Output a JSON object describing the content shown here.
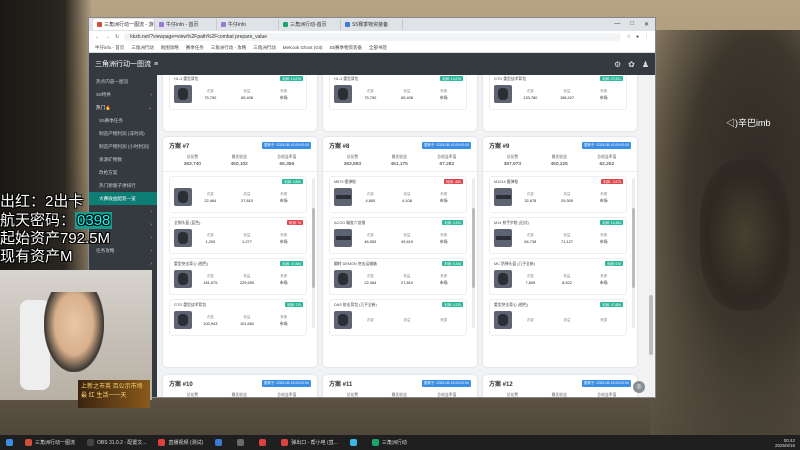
{
  "browser": {
    "tabs": [
      {
        "label": "三角洲行动一图流 - 游戏",
        "color": "#d24f3a",
        "active": true
      },
      {
        "label": "牛仔info - 首页",
        "color": "#9a7ad8",
        "active": false
      },
      {
        "label": "牛仔info",
        "color": "#9a7ad8",
        "active": false
      },
      {
        "label": "三角洲行动-首页",
        "color": "#1aa66b",
        "active": false
      },
      {
        "label": "S5赛季物资装备",
        "color": "#3a7ad8",
        "active": false
      }
    ],
    "url": "kkzb.net/?viewpage=view%2Fpath%2Fcombat prepare_value",
    "bookmarks": [
      "牛仔info - 首页",
      "三角洲行动",
      "地图攻略",
      "赛季任务",
      "三角洲行动 - 攻略",
      "三角洲行动",
      "MeKook Ghost (Git)",
      "S5赛季物资装备",
      "全部书签"
    ],
    "window_controls": [
      "—",
      "□",
      "✕"
    ]
  },
  "app": {
    "title": "三角洲行动一图流",
    "menu_icon": "≡",
    "header_icons": [
      "gear-icon",
      "settings-icon",
      "user-icon"
    ]
  },
  "sidebar": {
    "items": [
      {
        "label": "热点内容一图流",
        "arrow": "",
        "type": "top"
      },
      {
        "label": "S5特供",
        "arrow": "›",
        "type": "top"
      },
      {
        "label": "热门🔥",
        "arrow": "⌄",
        "type": "top-hl"
      },
      {
        "label": "S5赛季任务",
        "arrow": "",
        "type": "sub"
      },
      {
        "label": "制造产物利润 (非时间)",
        "arrow": "",
        "type": "sub"
      },
      {
        "label": "制造产物利润 (小时利润)",
        "arrow": "",
        "type": "sub"
      },
      {
        "label": "资源矿物数",
        "arrow": "",
        "type": "sub"
      },
      {
        "label": "改枪方案",
        "arrow": "",
        "type": "sub"
      },
      {
        "label": "热门新版子弹排行",
        "arrow": "",
        "type": "sub"
      },
      {
        "label": "大赛收益配装一览",
        "arrow": "",
        "type": "sub-active"
      },
      {
        "label": "",
        "arrow": "›",
        "type": "top"
      },
      {
        "label": "",
        "arrow": "›",
        "type": "top"
      },
      {
        "label": "",
        "arrow": "›",
        "type": "top"
      },
      {
        "label": "任务攻略",
        "arrow": "›",
        "type": "top"
      },
      {
        "label": "",
        "arrow": "›",
        "type": "top"
      },
      {
        "label": "",
        "arrow": "›",
        "type": "top"
      },
      {
        "label": "",
        "arrow": "›",
        "type": "top"
      },
      {
        "label": "",
        "arrow": "›",
        "type": "top"
      },
      {
        "label": "",
        "arrow": "›",
        "type": "top"
      },
      {
        "label": "",
        "arrow": "›",
        "type": "top"
      },
      {
        "label": "特別鸣谢",
        "arrow": "",
        "type": "top"
      },
      {
        "label": "关于赞助",
        "arrow": "",
        "type": "top"
      }
    ]
  },
  "labels": {
    "cost": "总花费",
    "value": "最优收益",
    "avg": "总收益率值",
    "i_cost": "花费",
    "i_value": "收益",
    "i_type": "来源"
  },
  "top_row_cards": [
    {
      "items": [
        {
          "name": "HL-3 重型背包",
          "badge": "利润: 14,676",
          "cost": "75,790",
          "value": "65,408",
          "type": "市场"
        }
      ]
    },
    {
      "items": [
        {
          "name": "HL-3 重型背包",
          "badge": "利润: 14,676",
          "cost": "75,790",
          "value": "65,408",
          "type": "市场"
        }
      ]
    },
    {
      "items": [
        {
          "name": "GTO 重型战术背包",
          "badge": "利润: 23,321",
          "cost": "133,780",
          "value": "158,427",
          "type": "市场"
        }
      ]
    }
  ],
  "plans_mid": [
    {
      "title": "方案 #7",
      "time": "更新于: 2025-08-15 00:00:00",
      "cost": "383,740",
      "value": "450,102",
      "avg": "66,356",
      "items": [
        {
          "name": "",
          "badge": "利润: 4,860",
          "badge_color": "green",
          "cost": "22,464",
          "value": "27,810",
          "type": "市场",
          "thumb": "bag"
        },
        {
          "name": "全钢头盔 (蓝色)",
          "badge": "利润: 74",
          "badge_color": "red",
          "cost": "1,203",
          "value": "1,277",
          "type": "市场",
          "thumb": "helmet"
        },
        {
          "name": "重型突击背心 (橙色)",
          "badge": "利润: 47,884",
          "badge_color": "green",
          "cost": "181,675",
          "value": "229,559",
          "type": "市场",
          "thumb": "vest"
        },
        {
          "name": "GTO 重型战术背包",
          "badge": "利润: 719",
          "badge_color": "green",
          "cost": "100,943",
          "value": "101,662",
          "type": "市场",
          "thumb": "bag"
        }
      ]
    },
    {
      "title": "方案 #8",
      "time": "更新于: 2025-08-15 00:00:00",
      "cost": "383,893",
      "value": "451,175",
      "avg": "67,282",
      "items": [
        {
          "name": "M870 霰弹枪",
          "badge": "利润: -683",
          "badge_color": "red",
          "cost": "4,800",
          "value": "4,108",
          "type": "市场",
          "thumb": "rifle"
        },
        {
          "name": "ACOG 瞄准六倍镜",
          "badge": "利润: 3,253",
          "badge_color": "green",
          "cost": "46,553",
          "value": "49,619",
          "type": "市场",
          "thumb": "scope"
        },
        {
          "name": "翻转 DEMON 突击运输箱",
          "badge": "利润: 5,346",
          "badge_color": "green",
          "cost": "22,464",
          "value": "27,810",
          "type": "市场",
          "thumb": "bag"
        },
        {
          "name": "DAS 射击背包 (几乎全新)",
          "badge": "利润: 4,233",
          "badge_color": "green",
          "cost": "",
          "value": "",
          "type": "",
          "thumb": "bag"
        }
      ]
    },
    {
      "title": "方案 #9",
      "time": "更新于: 2025-08-15 00:00:00",
      "cost": "387,973",
      "value": "450,225",
      "avg": "62,252",
      "items": [
        {
          "name": "M1014 霰弹枪",
          "badge": "利润: -3,573",
          "badge_color": "red",
          "cost": "32,878",
          "value": "29,305",
          "type": "市场",
          "thumb": "rifle"
        },
        {
          "name": "M14 射手步枪 (旧式)",
          "badge": "利润: 16,384",
          "badge_color": "green",
          "cost": "84,738",
          "value": "71,127",
          "type": "市场",
          "thumb": "rifle"
        },
        {
          "name": "MC 防弹头盔 (几乎全新)",
          "badge": "利润: 678",
          "badge_color": "green",
          "cost": "7,849",
          "value": "8,522",
          "type": "市场",
          "thumb": "helmet"
        },
        {
          "name": "重型突击背心 (橙色)",
          "badge": "利润: 47,884",
          "badge_color": "green",
          "cost": "",
          "value": "",
          "type": "",
          "thumb": "vest"
        }
      ]
    }
  ],
  "plans_bottom": [
    {
      "title": "方案 #10",
      "time": "更新于: 2025-08-15 00:00:00",
      "cost": "400,227",
      "value": "452,216",
      "avg": "51,989"
    },
    {
      "title": "方案 #11",
      "time": "更新于: 2025-08-15 00:00:00",
      "cost": "402,144",
      "value": "450,622",
      "avg": "48,478"
    },
    {
      "title": "方案 #12",
      "time": "更新于: 2025-08-15 00:00:00",
      "cost": "403,518",
      "value": "456,806",
      "avg": "52,988"
    }
  ],
  "overlay": {
    "line1": "出红：2出卡",
    "line2_prefix": "航天密码：",
    "line2_code": "0398",
    "line3": "起始资产792.5M",
    "line4": "现有资产M",
    "right_label": "◁)辛巴imb",
    "banner": "上新之市英 百公示市场 最 红 生活一一天"
  },
  "taskbar": {
    "items": [
      {
        "label": "三角洲行动一图流",
        "color": "#d24f3a"
      },
      {
        "label": "OBS 31.0.2 - 配置文...",
        "color": "#444"
      },
      {
        "label": "直播视频 (测试)",
        "color": "#e04040"
      },
      {
        "label": "",
        "color": "#3a7ad8"
      },
      {
        "label": "",
        "color": "#6a6a6a"
      },
      {
        "label": "",
        "color": "#e04040"
      },
      {
        "label": "弹出口 - 帮小电 (直...",
        "color": "#e04040"
      },
      {
        "label": "",
        "color": "#3ab8e8"
      },
      {
        "label": "三角洲行动",
        "color": "#1aa66b"
      }
    ],
    "time": "00:42",
    "date": "2025/8/15"
  }
}
